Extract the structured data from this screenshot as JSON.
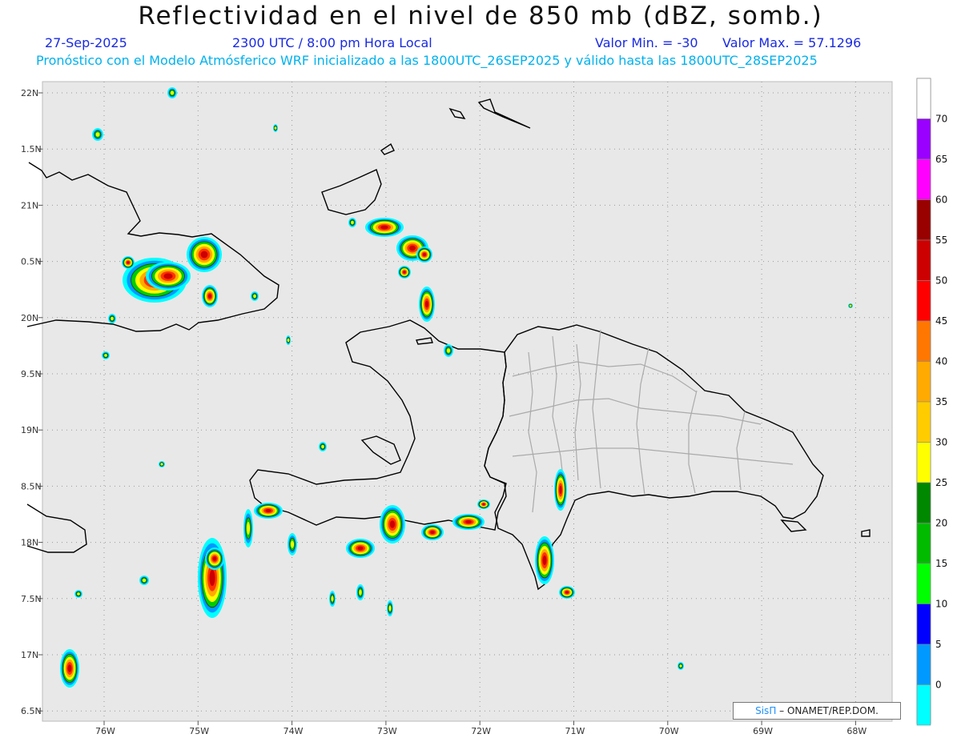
{
  "header": {
    "title": "Reflectividad en el nivel de 850 mb (dBZ, somb.)",
    "date": "27-Sep-2025",
    "time": "2300 UTC / 8:00 pm Hora Local",
    "min_label": "Valor Min. = -30",
    "max_label": "Valor Max. = 57.1296",
    "forecast_line": "Pronóstico con el Modelo Atmósferico WRF inicializado a las 1800UTC_26SEP2025 y válido hasta las  1800UTC_28SEP2025"
  },
  "map": {
    "lat_labels": [
      "22N",
      "1.5N",
      "21N",
      "0.5N",
      "20N",
      "9.5N",
      "19N",
      "8.5N",
      "18N",
      "7.5N",
      "17N",
      "6.5N"
    ],
    "lon_labels": [
      "76W",
      "75W",
      "74W",
      "73W",
      "72W",
      "71W",
      "70W",
      "69W",
      "68W"
    ],
    "lat_range": [
      16.5,
      22.0
    ],
    "lon_range": [
      -76.6,
      -67.6
    ],
    "background_color": "#e8e8e8"
  },
  "colorbar": {
    "labels": [
      "70",
      "65",
      "60",
      "55",
      "50",
      "45",
      "40",
      "35",
      "30",
      "25",
      "20",
      "15",
      "10",
      "5",
      "0"
    ],
    "colors": [
      "#ffffff",
      "#9900ff",
      "#ff00ff",
      "#990000",
      "#cc0000",
      "#ff0000",
      "#ff7700",
      "#ffaa00",
      "#ffcc00",
      "#ffff00",
      "#008800",
      "#00bb00",
      "#00ff00",
      "#0000ff",
      "#0099ff",
      "#00ffff",
      "#e8e8e8"
    ]
  },
  "credit": {
    "brand": "SisΠ",
    "text": "– ONAMET/REP.DOM."
  }
}
